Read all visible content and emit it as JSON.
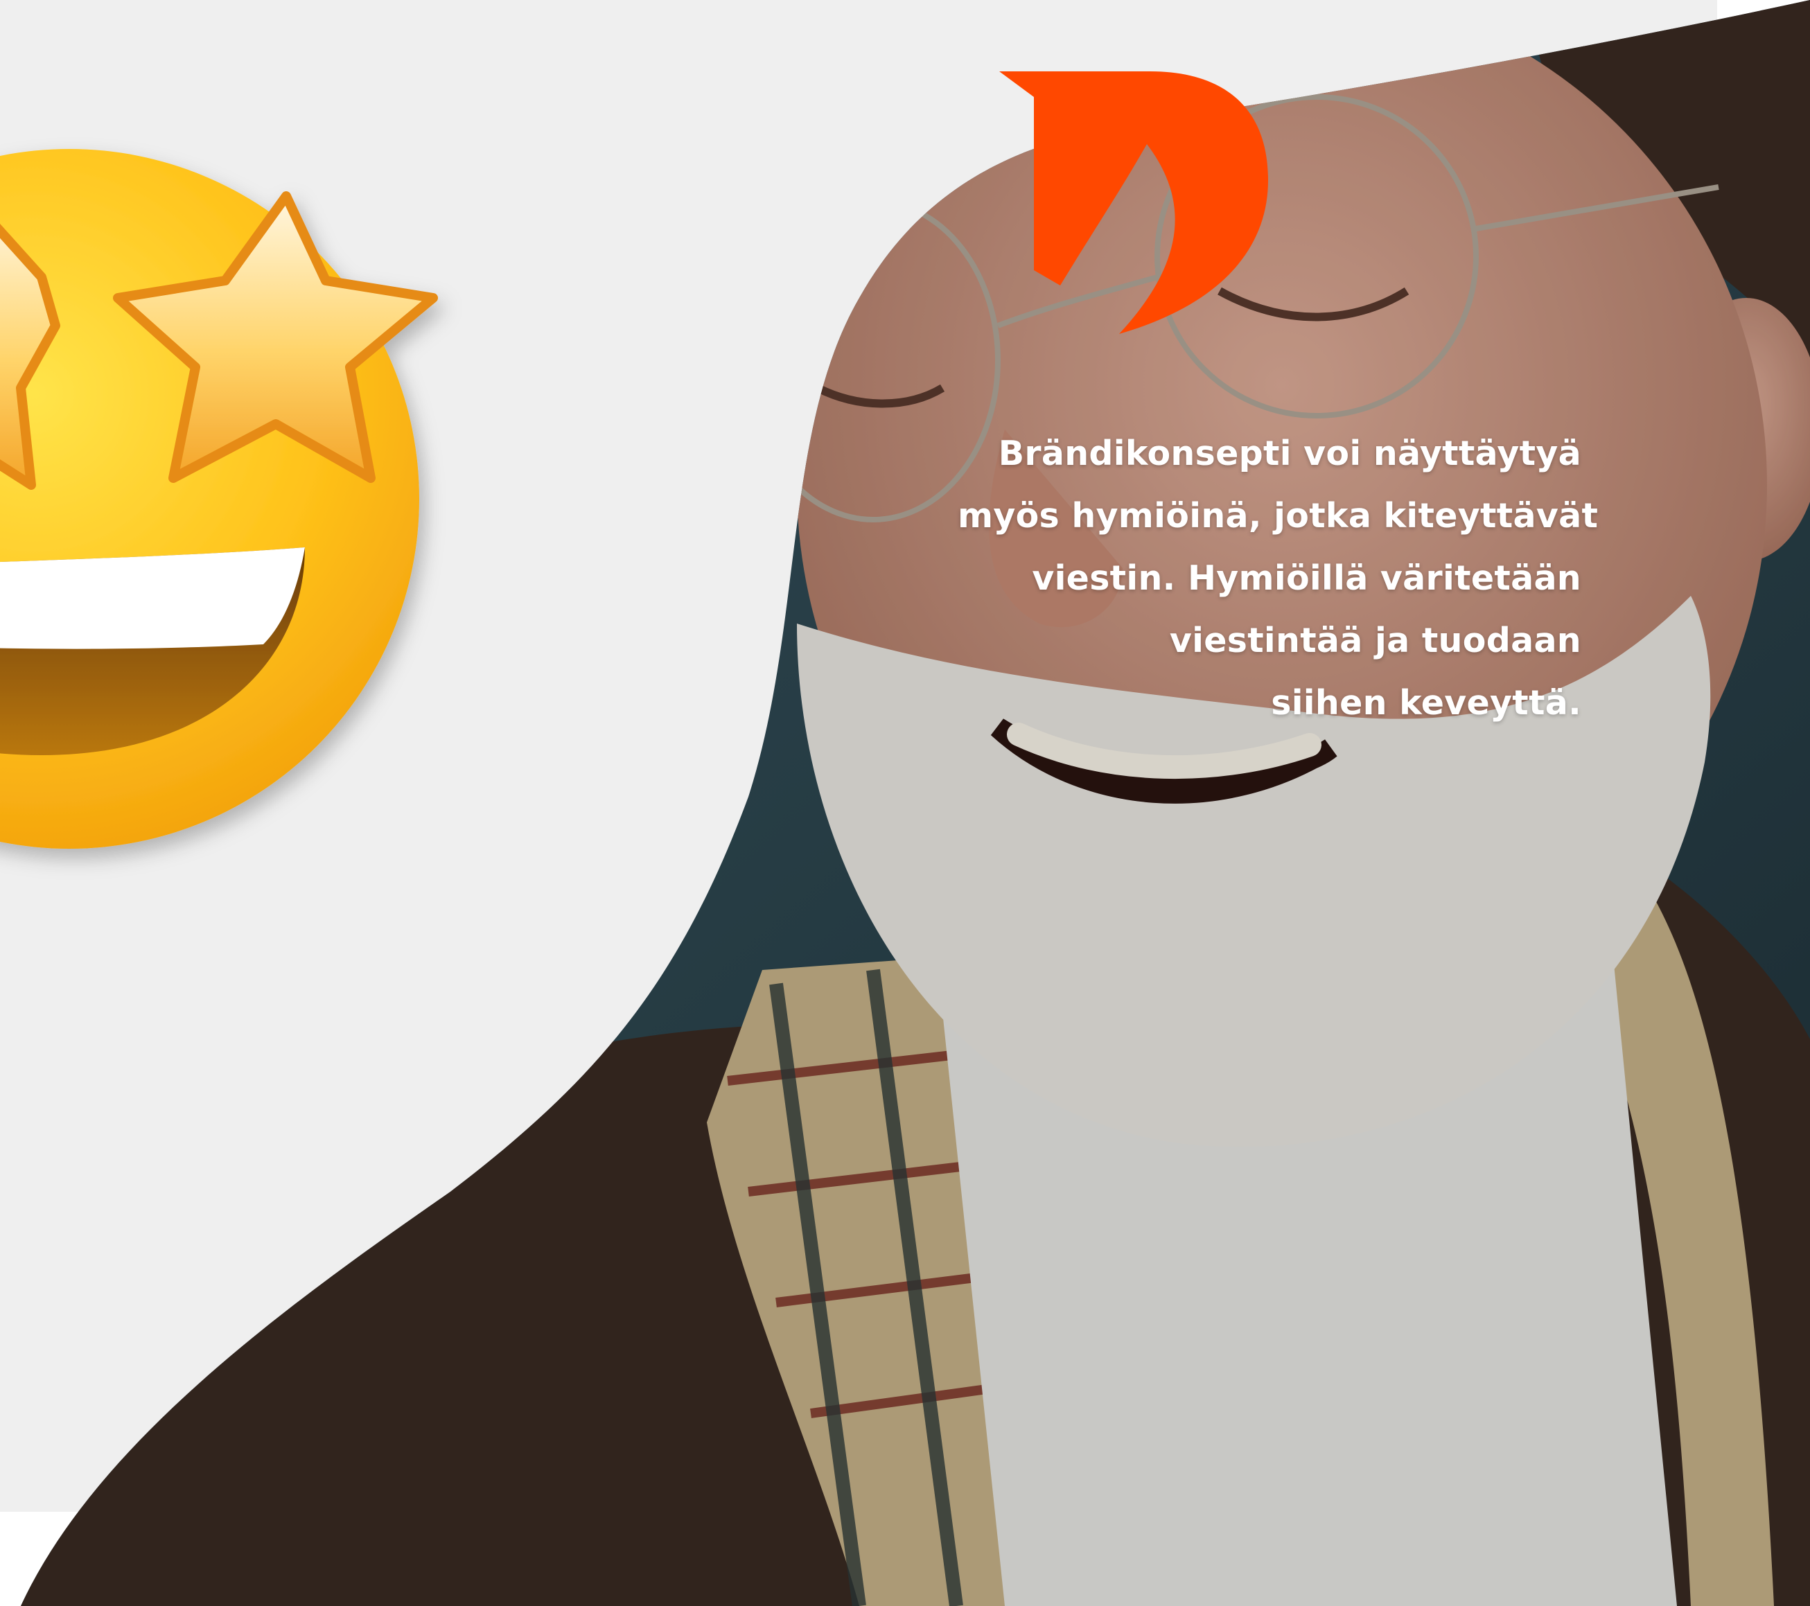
{
  "caption": {
    "lines": [
      "Brändikonsepti voi näyttäytyä",
      "myös hymiöinä, jotka kiteyttävät",
      "viestin. Hymiöillä väritetään",
      "viestintää ja tuodaan",
      "siihen keveyttä."
    ]
  },
  "colors": {
    "background": "#efefef",
    "brand_accent": "#ff4800",
    "emoji_yellow": "#ffcc1d",
    "caption_text": "#ffffff"
  },
  "icons": {
    "emoji": "star-struck-emoji-icon",
    "logo": "brand-logo-mark-icon"
  }
}
